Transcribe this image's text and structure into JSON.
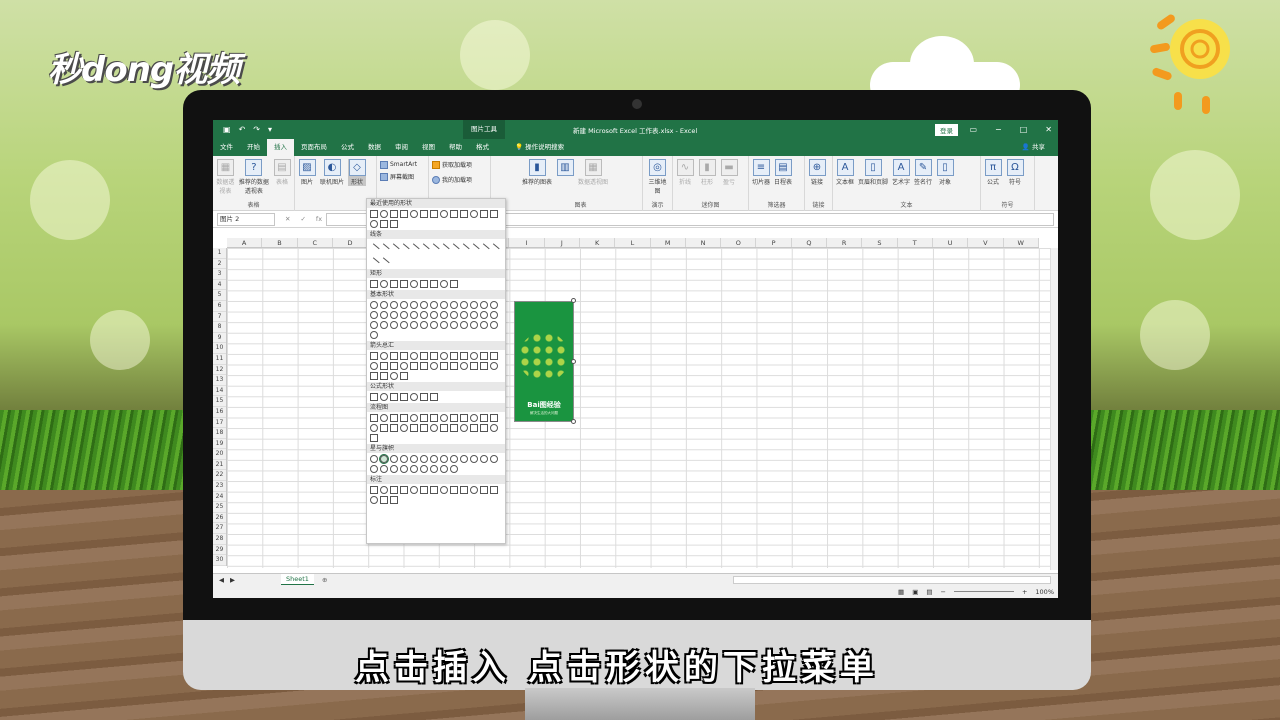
{
  "logo_text": "秒dong视频",
  "subtitle": "点击插入 点击形状的下拉菜单",
  "excel": {
    "title_bar": {
      "context_tab": "图片工具",
      "filename": "新建 Microsoft Excel 工作表.xlsx  -  Excel",
      "login": "登录"
    },
    "tabs": [
      "文件",
      "开始",
      "插入",
      "页面布局",
      "公式",
      "数据",
      "审阅",
      "视图",
      "帮助",
      "格式"
    ],
    "active_tab": "插入",
    "search_label": "操作说明搜索",
    "share_label": "共享",
    "ribbon_groups": [
      {
        "name": "表格",
        "buttons": [
          "数据透视表",
          "推荐的数据透视表",
          "表格"
        ]
      },
      {
        "name": "",
        "buttons": [
          "图片",
          "联机图片",
          "形状"
        ]
      },
      {
        "name": "",
        "small": [
          "SmartArt",
          "屏幕截图"
        ]
      },
      {
        "name": "",
        "small": [
          "获取加载项",
          "我的加载项"
        ]
      },
      {
        "name": "图表",
        "buttons": [
          "推荐的图表",
          "数据透视图"
        ]
      },
      {
        "name": "演示",
        "buttons": [
          "三维地图"
        ]
      },
      {
        "name": "迷你图",
        "buttons": [
          "折线",
          "柱形",
          "盈亏"
        ]
      },
      {
        "name": "筛选器",
        "buttons": [
          "切片器",
          "日程表"
        ]
      },
      {
        "name": "链接",
        "buttons": [
          "链接"
        ]
      },
      {
        "name": "文本",
        "buttons": [
          "文本框",
          "页眉和页脚",
          "艺术字",
          "签名行",
          "对象"
        ]
      },
      {
        "name": "符号",
        "buttons": [
          "公式",
          "符号"
        ]
      }
    ],
    "name_box": "图片 2",
    "columns": [
      "A",
      "B",
      "C",
      "D",
      "E",
      "F",
      "G",
      "H",
      "I",
      "J",
      "K",
      "L",
      "M",
      "N",
      "O",
      "P",
      "Q",
      "R",
      "S",
      "T",
      "U",
      "V",
      "W"
    ],
    "rows": [
      "1",
      "2",
      "3",
      "4",
      "5",
      "6",
      "7",
      "8",
      "9",
      "10",
      "11",
      "12",
      "13",
      "14",
      "15",
      "16",
      "17",
      "18",
      "19",
      "20",
      "21",
      "22",
      "23",
      "24",
      "25",
      "26",
      "27",
      "28",
      "29",
      "30"
    ],
    "sheet_tab": "Sheet1",
    "zoom": "100%",
    "shapes_menu": {
      "sections": [
        "最近使用的形状",
        "线条",
        "矩形",
        "基本形状",
        "箭头总汇",
        "公式形状",
        "流程图",
        "星与旗帜",
        "标注"
      ]
    },
    "image": {
      "brand": "Bai图经验",
      "sub": "解决生活的大问题"
    }
  }
}
